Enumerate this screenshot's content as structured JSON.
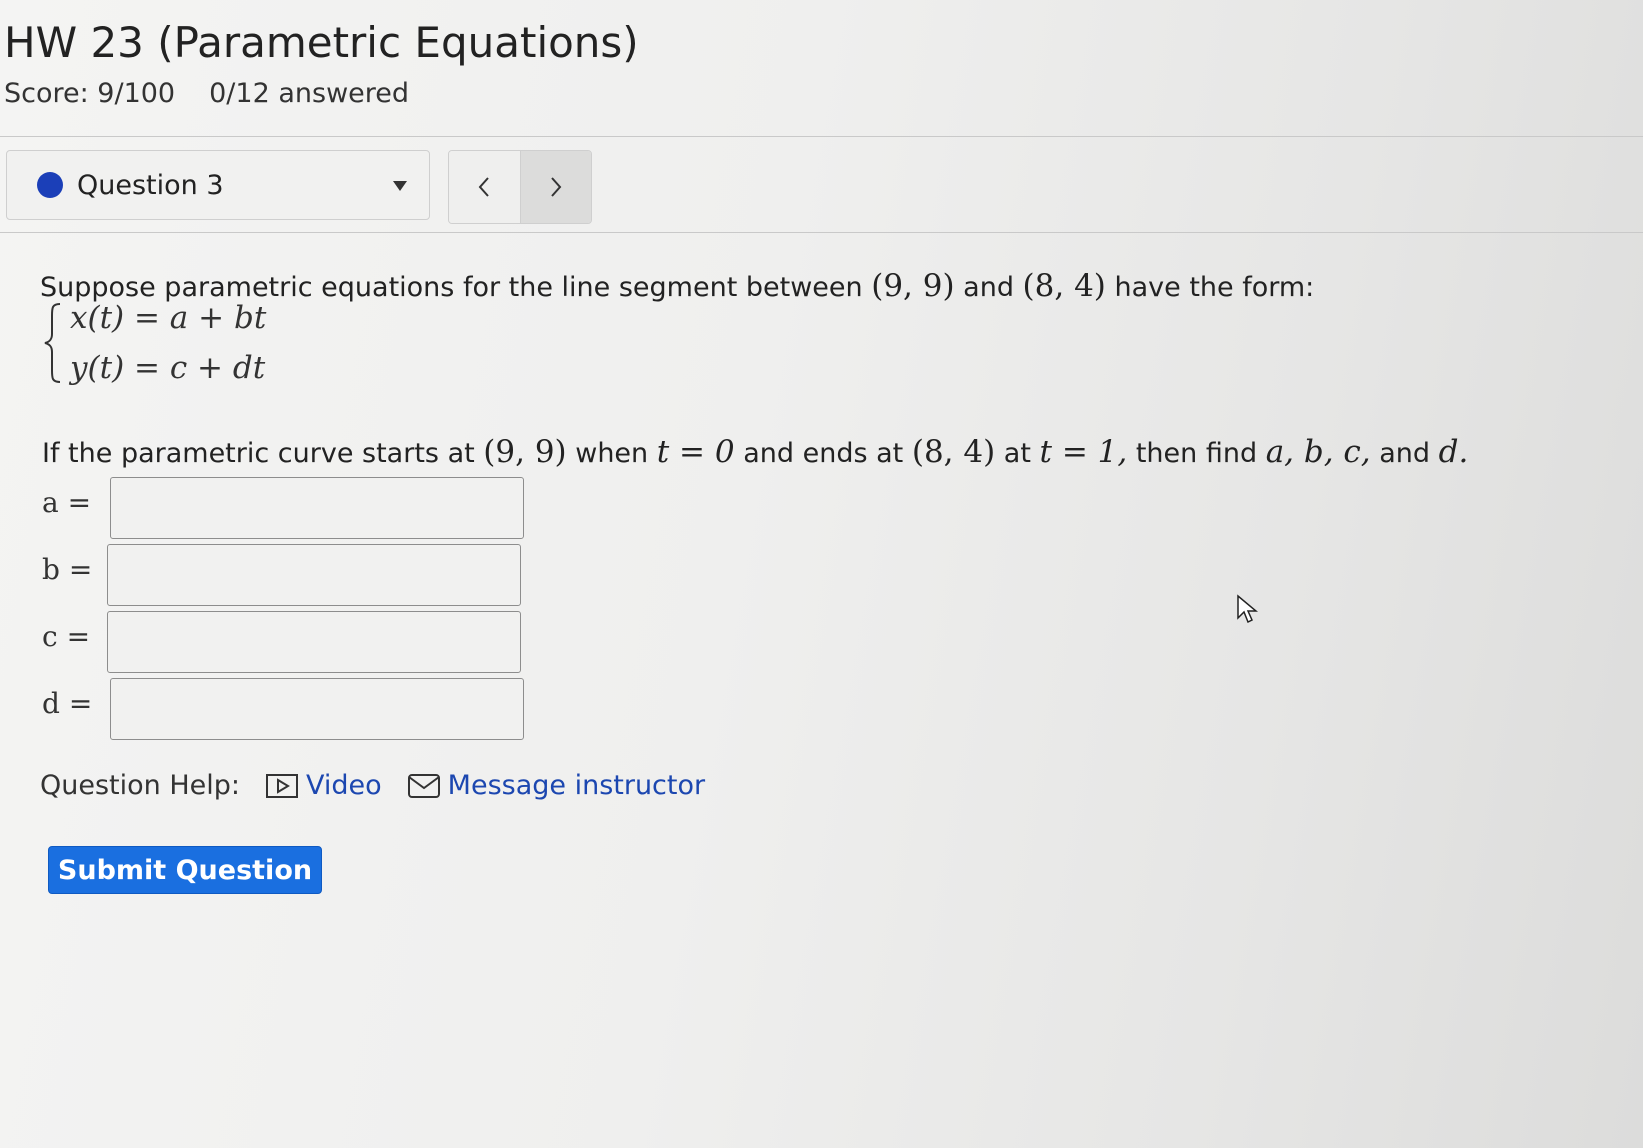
{
  "assignment": {
    "title": "HW 23 (Parametric Equations)",
    "score": "Score: 9/100",
    "answered": "0/12 answered"
  },
  "question_nav": {
    "selected": "Question 3",
    "prev_label": "<",
    "next_label": ">"
  },
  "question": {
    "intro": "Suppose parametric equations for the line segment between",
    "point1": "(9, 9)",
    "and": "and",
    "point2": "(8, 4)",
    "have_form": "have the form:",
    "eq_x": "x(t) = a + bt",
    "eq_y": "y(t) = c + dt",
    "instruction": {
      "p1": "If the parametric curve starts at",
      "start": "(9, 9)",
      "p2": "when",
      "t0": "t = 0",
      "p3": "and ends at",
      "end": "(8, 4)",
      "p4": "at",
      "t1": "t = 1,",
      "p5": "then find",
      "vars": "a, b, c,",
      "p6": "and",
      "last_var": "d."
    }
  },
  "answers": [
    {
      "label": "a =",
      "value": ""
    },
    {
      "label": "b =",
      "value": ""
    },
    {
      "label": "c =",
      "value": ""
    },
    {
      "label": "d =",
      "value": ""
    }
  ],
  "help": {
    "label": "Question Help:",
    "video": "Video",
    "message": "Message instructor"
  },
  "submit_label": "Submit Question",
  "colors": {
    "question_dot": "#1b3fb8",
    "link": "#1c47b0",
    "submit_bg": "#1a6fe0"
  }
}
